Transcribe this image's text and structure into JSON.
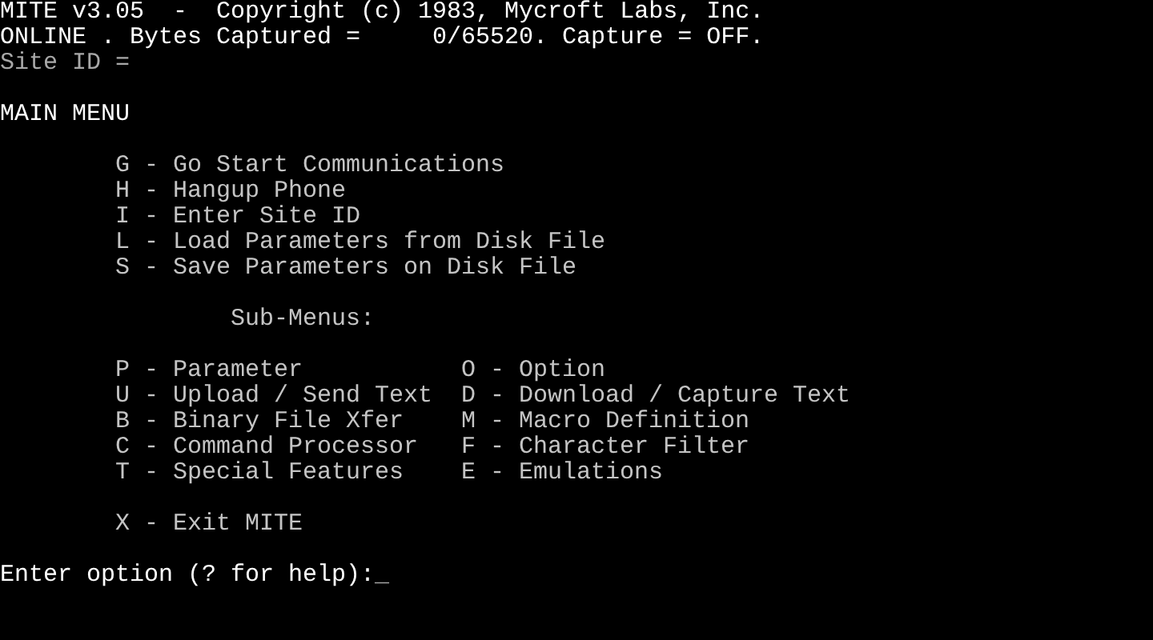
{
  "header": {
    "title_line": "MITE v3.05  -  Copyright (c) 1983, Mycroft Labs, Inc.",
    "status_line": "ONLINE . Bytes Captured =     0/65520. Capture = OFF.",
    "site_line": "Site ID ="
  },
  "main_menu": {
    "title": "MAIN MENU",
    "items": [
      "G - Go Start Communications",
      "H - Hangup Phone",
      "I - Enter Site ID",
      "L - Load Parameters from Disk File",
      "S - Save Parameters on Disk File"
    ]
  },
  "sub_menus": {
    "heading": "Sub-Menus:",
    "rows": [
      [
        "P - Parameter",
        "O - Option"
      ],
      [
        "U - Upload / Send Text",
        "D - Download / Capture Text"
      ],
      [
        "B - Binary File Xfer",
        "M - Macro Definition"
      ],
      [
        "C - Command Processor",
        "F - Character Filter"
      ],
      [
        "T - Special Features",
        "E - Emulations"
      ]
    ]
  },
  "exit_item": "X - Exit MITE",
  "prompt": {
    "text": "Enter option (? for help):",
    "cursor": "_"
  }
}
